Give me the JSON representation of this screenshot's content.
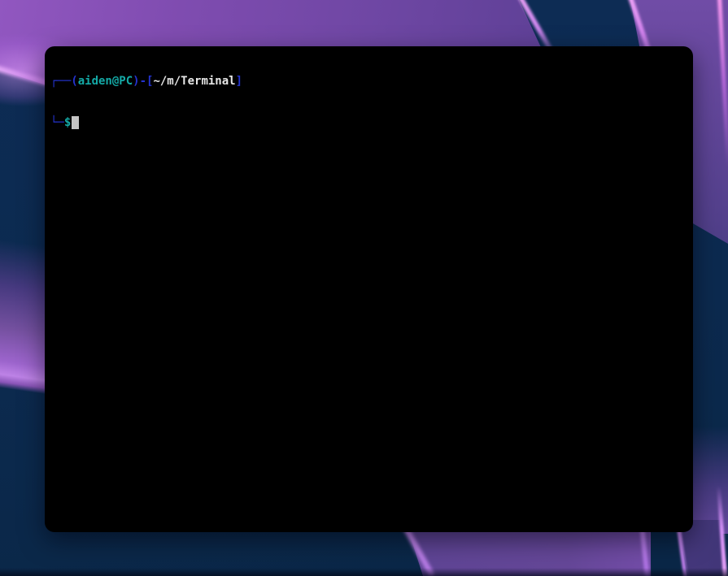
{
  "desktop": {
    "wallpaper_colors": {
      "base_navy": "#0c2a50",
      "ribbon_purple": "#7f4cb0",
      "ribbon_edge_glow": "#e0a0f5"
    }
  },
  "terminal": {
    "background": "#000000",
    "prompt": {
      "line1": {
        "open": "┌──(",
        "user_host": "aiden@PC",
        "separator": ")-[",
        "path": "~/m/Terminal",
        "close": "]"
      },
      "line2": {
        "corner": "└─",
        "symbol": "$"
      }
    },
    "colors": {
      "frame_blue": "#2433d0",
      "user_teal": "#14a9a6",
      "path_white": "#e6e6e6",
      "cursor_gray": "#c4c4c4"
    }
  }
}
